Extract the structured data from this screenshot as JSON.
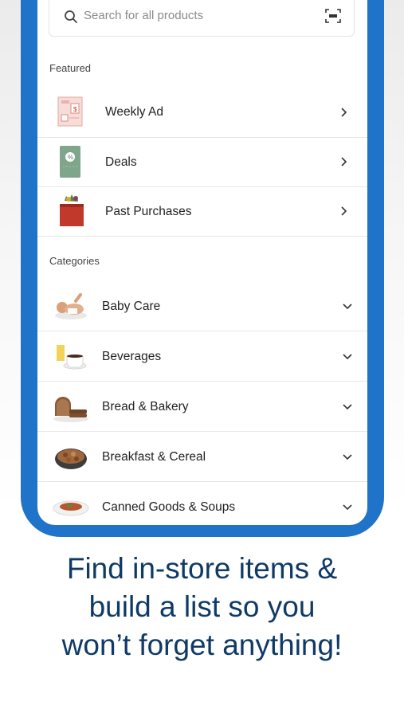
{
  "search": {
    "placeholder": "Search for all products",
    "icon": "search-icon",
    "scan_icon": "barcode-scan-icon"
  },
  "featured": {
    "heading": "Featured",
    "items": [
      {
        "label": "Weekly Ad",
        "icon": "weekly-ad-icon"
      },
      {
        "label": "Deals",
        "icon": "deals-coupon-icon"
      },
      {
        "label": "Past Purchases",
        "icon": "shopping-bag-icon"
      }
    ]
  },
  "categories": {
    "heading": "Categories",
    "items": [
      {
        "label": "Baby Care"
      },
      {
        "label": "Beverages"
      },
      {
        "label": "Bread & Bakery"
      },
      {
        "label": "Breakfast & Cereal"
      },
      {
        "label": "Canned Goods & Soups"
      }
    ]
  },
  "headline": {
    "line1": "Find in-store items &",
    "line2": "build a list so you",
    "line3": "won’t forget anything!"
  },
  "colors": {
    "frame": "#1f73c9",
    "headline": "#0f3a66"
  }
}
